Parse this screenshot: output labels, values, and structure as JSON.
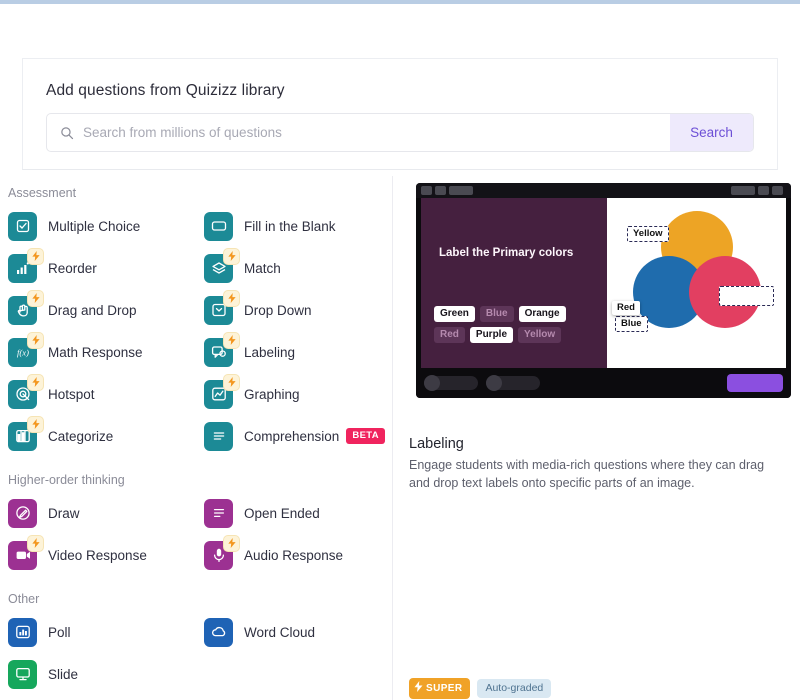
{
  "search": {
    "title": "Add questions from Quizizz library",
    "placeholder": "Search from millions of questions",
    "value": "",
    "button_label": "Search",
    "icon": "search-icon"
  },
  "sections": [
    {
      "heading": "Assessment",
      "color": "#1c8a96",
      "items": [
        {
          "label": "Multiple Choice",
          "icon": "checkbox-icon",
          "super": false,
          "beta": false
        },
        {
          "label": "Fill in the Blank",
          "icon": "rectangle-icon",
          "super": false,
          "beta": false
        },
        {
          "label": "Reorder",
          "icon": "bars-icon",
          "super": true,
          "beta": false
        },
        {
          "label": "Match",
          "icon": "layers-icon",
          "super": true,
          "beta": false
        },
        {
          "label": "Drag and Drop",
          "icon": "hand-icon",
          "super": true,
          "beta": false
        },
        {
          "label": "Drop Down",
          "icon": "dropdown-icon",
          "super": true,
          "beta": false
        },
        {
          "label": "Math Response",
          "icon": "function-icon",
          "super": true,
          "beta": false
        },
        {
          "label": "Labeling",
          "icon": "label-tag-icon",
          "super": true,
          "beta": false
        },
        {
          "label": "Hotspot",
          "icon": "target-icon",
          "super": true,
          "beta": false
        },
        {
          "label": "Graphing",
          "icon": "line-chart-icon",
          "super": true,
          "beta": false
        },
        {
          "label": "Categorize",
          "icon": "columns-icon",
          "super": true,
          "beta": false
        },
        {
          "label": "Comprehension",
          "icon": "lines-icon",
          "super": false,
          "beta": true
        }
      ]
    },
    {
      "heading": "Higher-order thinking",
      "color": "#9c3192",
      "items": [
        {
          "label": "Draw",
          "icon": "pencil-circle-icon",
          "super": false,
          "beta": false
        },
        {
          "label": "Open Ended",
          "icon": "text-lines-icon",
          "super": false,
          "beta": false
        },
        {
          "label": "Video Response",
          "icon": "video-icon",
          "super": true,
          "beta": false
        },
        {
          "label": "Audio Response",
          "icon": "microphone-icon",
          "super": true,
          "beta": false
        }
      ]
    },
    {
      "heading": "Other",
      "items": [
        {
          "label": "Poll",
          "icon": "poll-chart-icon",
          "color": "#1f63b5",
          "super": false,
          "beta": false
        },
        {
          "label": "Word Cloud",
          "icon": "cloud-icon",
          "color": "#1f63b5",
          "super": false,
          "beta": false
        },
        {
          "label": "Slide",
          "icon": "monitor-icon",
          "color": "#16a75c",
          "super": false,
          "beta": false
        }
      ]
    }
  ],
  "badge_labels": {
    "beta": "BETA",
    "super": "SUPER",
    "auto_graded": "Auto-graded"
  },
  "preview": {
    "question_title": "Label the Primary colors",
    "answer_chips": [
      {
        "label": "Green",
        "state": "on"
      },
      {
        "label": "Blue",
        "state": "off"
      },
      {
        "label": "Orange",
        "state": "on"
      },
      {
        "label": "Red",
        "state": "off"
      },
      {
        "label": "Purple",
        "state": "on"
      },
      {
        "label": "Yellow",
        "state": "off"
      }
    ],
    "image_labels": [
      {
        "label": "Yellow",
        "placed": true
      },
      {
        "label": "Red",
        "placed": true
      },
      {
        "label": "Blue",
        "placed": true
      }
    ],
    "venn_colors": {
      "yellow": "#eda425",
      "blue": "#1f6cad",
      "red": "#e23f61"
    },
    "title": "Labeling",
    "description": "Engage students with media-rich questions where they can drag and drop text labels onto specific parts of an image."
  },
  "colors": {
    "teal": "#1c8a96",
    "magenta": "#9c3192",
    "blue": "#1f63b5",
    "green": "#16a75c",
    "accent_purple": "#6c4fd6",
    "beta_pink": "#f0245e",
    "super_orange": "#f0a227"
  }
}
